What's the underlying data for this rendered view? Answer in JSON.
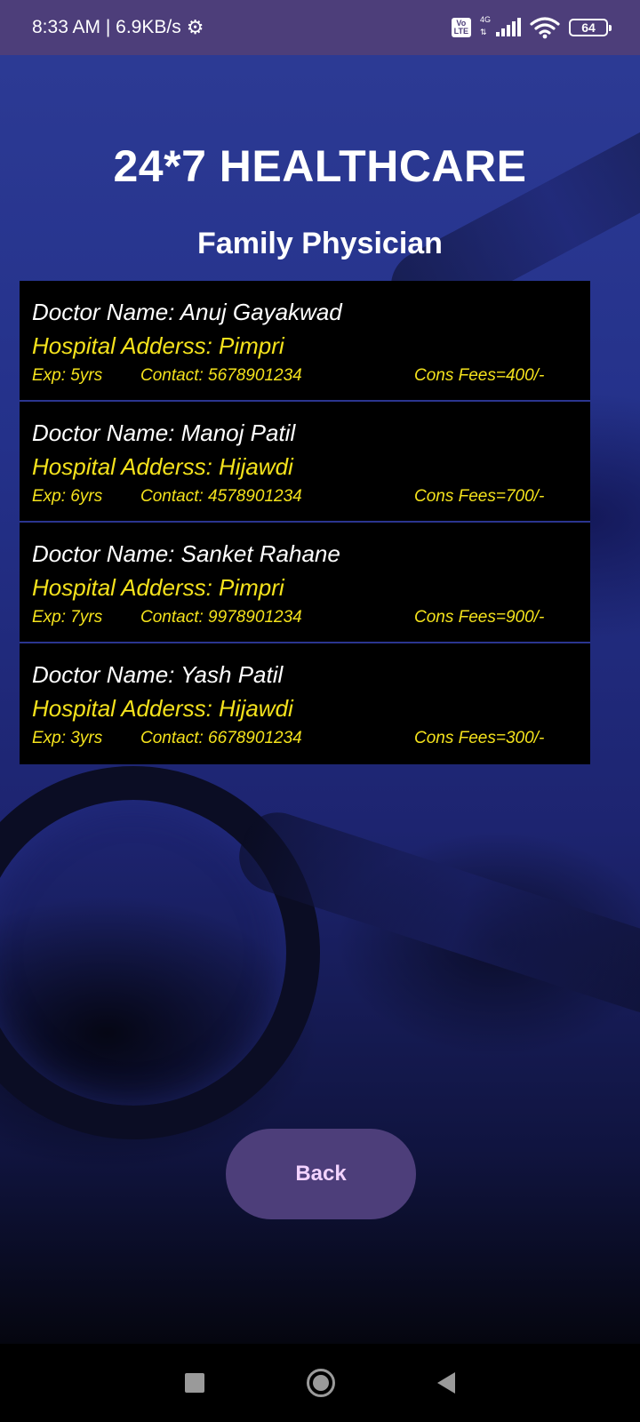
{
  "status_bar": {
    "time_speed": "8:33 AM | 6.9KB/s",
    "gear_icon": "gear-icon",
    "volte": "Vo LTE",
    "network": "4G",
    "battery": "64"
  },
  "header": {
    "title": "24*7 HEALTHCARE",
    "subtitle": "Family Physician"
  },
  "doctors": [
    {
      "name": "Doctor Name: Anuj Gayakwad",
      "address": "Hospital Adderss: Pimpri",
      "exp": "Exp: 5yrs",
      "contact": "Contact: 5678901234",
      "fees": "Cons Fees=400/-"
    },
    {
      "name": "Doctor Name: Manoj Patil",
      "address": "Hospital Adderss: Hijawdi",
      "exp": "Exp: 6yrs",
      "contact": "Contact: 4578901234",
      "fees": "Cons Fees=700/-"
    },
    {
      "name": "Doctor Name: Sanket Rahane",
      "address": "Hospital Adderss: Pimpri",
      "exp": "Exp: 7yrs",
      "contact": "Contact: 9978901234",
      "fees": "Cons Fees=900/-"
    },
    {
      "name": "Doctor Name: Yash Patil",
      "address": "Hospital Adderss: Hijawdi",
      "exp": "Exp: 3yrs",
      "contact": "Contact: 6678901234",
      "fees": "Cons Fees=300/-"
    }
  ],
  "back_button": {
    "label": "Back"
  },
  "colors": {
    "accent": "#4d3e7a",
    "highlight_text": "#f4e21c",
    "button_text": "#f3d3ff"
  },
  "nav_bar": {
    "icons": [
      "recents-square-icon",
      "home-circle-icon",
      "back-triangle-icon"
    ]
  }
}
